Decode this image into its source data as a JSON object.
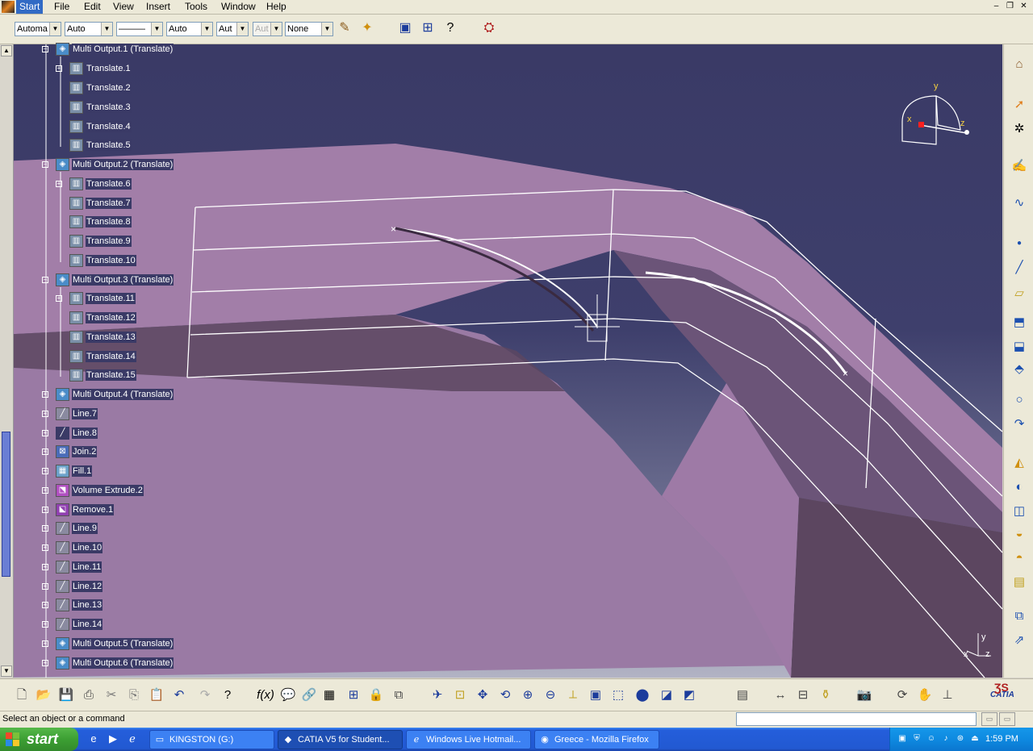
{
  "menubar": {
    "items": [
      "Start",
      "File",
      "Edit",
      "View",
      "Insert",
      "Tools",
      "Window",
      "Help"
    ]
  },
  "toolbar_top": {
    "combos": [
      {
        "value": "Automa",
        "disabled": false
      },
      {
        "value": "Auto",
        "disabled": false
      },
      {
        "value": "———",
        "disabled": false
      },
      {
        "value": "Auto",
        "disabled": false
      },
      {
        "value": "Aut",
        "disabled": false
      },
      {
        "value": "Aut",
        "disabled": true
      },
      {
        "value": "None",
        "disabled": false
      }
    ]
  },
  "tree": {
    "items": [
      {
        "label": "Multi Output.1 (Translate)",
        "icon": "multi-output-icon",
        "level": 0,
        "expand": "-"
      },
      {
        "label": "Translate.1",
        "icon": "translate-icon",
        "level": 1,
        "expand": "+"
      },
      {
        "label": "Translate.2",
        "icon": "translate-icon",
        "level": 1,
        "expand": ""
      },
      {
        "label": "Translate.3",
        "icon": "translate-icon",
        "level": 1,
        "expand": ""
      },
      {
        "label": "Translate.4",
        "icon": "translate-icon",
        "level": 1,
        "expand": ""
      },
      {
        "label": "Translate.5",
        "icon": "translate-icon",
        "level": 1,
        "expand": ""
      },
      {
        "label": "Multi Output.2 (Translate)",
        "icon": "multi-output-icon",
        "level": 0,
        "expand": "-"
      },
      {
        "label": "Translate.6",
        "icon": "translate-icon",
        "level": 1,
        "expand": "+"
      },
      {
        "label": "Translate.7",
        "icon": "translate-icon",
        "level": 1,
        "expand": ""
      },
      {
        "label": "Translate.8",
        "icon": "translate-icon",
        "level": 1,
        "expand": ""
      },
      {
        "label": "Translate.9",
        "icon": "translate-icon",
        "level": 1,
        "expand": ""
      },
      {
        "label": "Translate.10",
        "icon": "translate-icon",
        "level": 1,
        "expand": ""
      },
      {
        "label": "Multi Output.3 (Translate)",
        "icon": "multi-output-icon",
        "level": 0,
        "expand": "-"
      },
      {
        "label": "Translate.11",
        "icon": "translate-icon",
        "level": 1,
        "expand": "+"
      },
      {
        "label": "Translate.12",
        "icon": "translate-icon",
        "level": 1,
        "expand": ""
      },
      {
        "label": "Translate.13",
        "icon": "translate-icon",
        "level": 1,
        "expand": ""
      },
      {
        "label": "Translate.14",
        "icon": "translate-icon",
        "level": 1,
        "expand": ""
      },
      {
        "label": "Translate.15",
        "icon": "translate-icon",
        "level": 1,
        "expand": ""
      },
      {
        "label": "Multi Output.4 (Translate)",
        "icon": "multi-output-icon",
        "level": 0,
        "expand": "+"
      },
      {
        "label": "Line.7",
        "icon": "line-icon",
        "level": 0,
        "expand": "+"
      },
      {
        "label": "Line.8",
        "icon": "line-icon",
        "level": 0,
        "expand": "+"
      },
      {
        "label": "Join.2",
        "icon": "join-icon",
        "level": 0,
        "expand": "+"
      },
      {
        "label": "Fill.1",
        "icon": "fill-icon",
        "level": 0,
        "expand": "+"
      },
      {
        "label": "Volume Extrude.2",
        "icon": "volume-extrude-icon",
        "level": 0,
        "expand": "+"
      },
      {
        "label": "Remove.1",
        "icon": "remove-icon",
        "level": 0,
        "expand": "+"
      },
      {
        "label": "Line.9",
        "icon": "line-icon",
        "level": 0,
        "expand": "+"
      },
      {
        "label": "Line.10",
        "icon": "line-icon",
        "level": 0,
        "expand": "+"
      },
      {
        "label": "Line.11",
        "icon": "line-icon",
        "level": 0,
        "expand": "+"
      },
      {
        "label": "Line.12",
        "icon": "line-icon",
        "level": 0,
        "expand": "+"
      },
      {
        "label": "Line.13",
        "icon": "line-icon",
        "level": 0,
        "expand": "+"
      },
      {
        "label": "Line.14",
        "icon": "line-icon",
        "level": 0,
        "expand": "+"
      },
      {
        "label": "Multi Output.5 (Translate)",
        "icon": "multi-output-icon",
        "level": 0,
        "expand": "+"
      },
      {
        "label": "Multi Output.6 (Translate)",
        "icon": "multi-output-icon",
        "level": 0,
        "expand": "+"
      }
    ]
  },
  "compass": {
    "x_label": "x",
    "y_label": "y",
    "z_label": "z"
  },
  "viewport": {
    "colors": {
      "background_top": "#3a3a66",
      "surface": "#a27ea8",
      "surface_dark": "#6b5478",
      "solid_dark": "#5c4660",
      "wire": "#ffffff"
    },
    "corner_axes": {
      "x": "x",
      "y": "y",
      "z": "z"
    }
  },
  "status": {
    "text": "Select an object or a command"
  },
  "taskbar": {
    "start_label": "start",
    "tasks": [
      {
        "label": "KINGSTON (G:)",
        "icon": "drive-icon",
        "active": false
      },
      {
        "label": "CATIA V5 for Student...",
        "icon": "catia-icon",
        "active": true
      },
      {
        "label": "Windows Live Hotmail...",
        "icon": "ie-icon",
        "active": false
      },
      {
        "label": "Greece - Mozilla Firefox",
        "icon": "firefox-icon",
        "active": false
      }
    ],
    "clock": "1:59 PM"
  },
  "brand": {
    "catia_label": "CATIA"
  }
}
